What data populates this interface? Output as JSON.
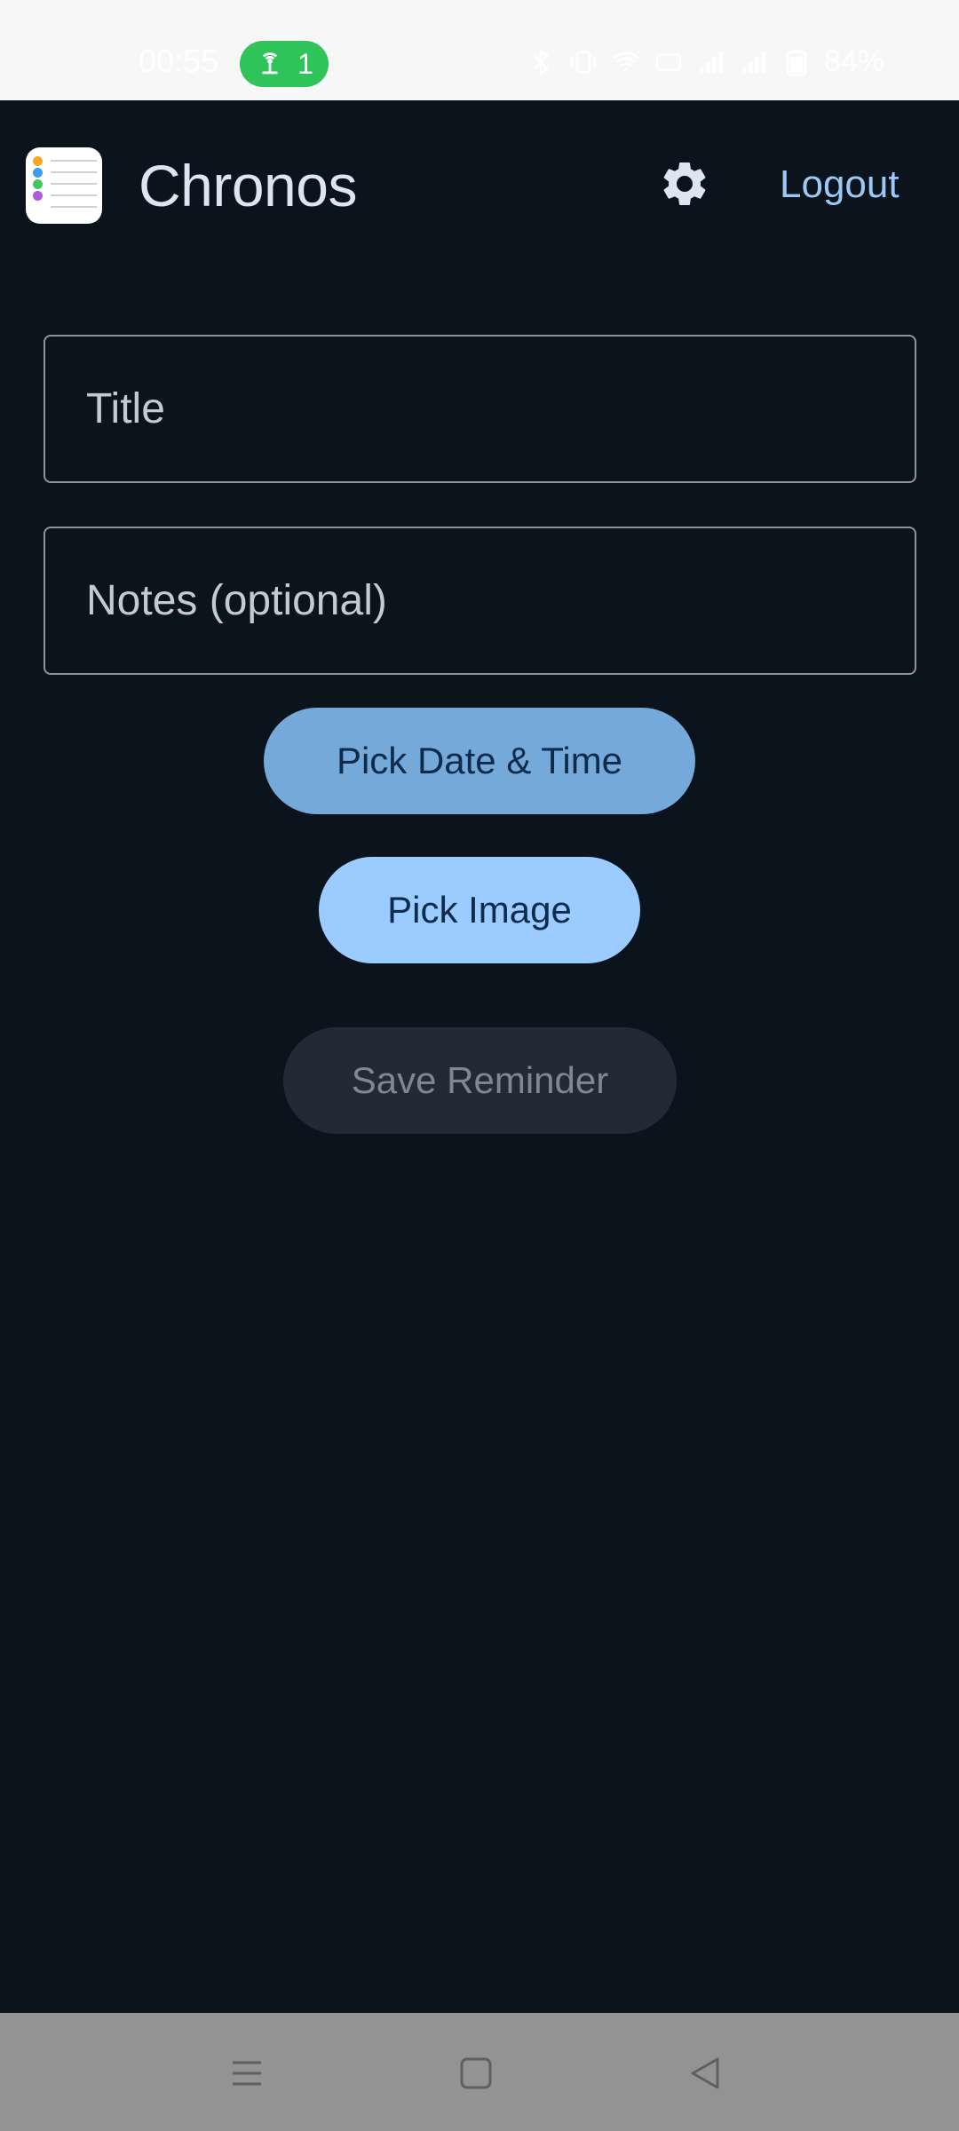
{
  "status_bar": {
    "time": "00:55",
    "hotspot_count": "1",
    "battery": "84%",
    "icons": [
      "bluetooth-icon",
      "vibrate-icon",
      "wifi-icon",
      "hd-icon",
      "signal-icon",
      "signal-icon",
      "battery-icon"
    ]
  },
  "header": {
    "app_name": "Chronos",
    "settings_icon": "gear-icon",
    "logout_label": "Logout"
  },
  "form": {
    "title_placeholder": "Title",
    "title_value": "",
    "notes_placeholder": "Notes (optional)",
    "notes_value": "",
    "pick_date_label": "Pick Date & Time",
    "pick_image_label": "Pick Image",
    "save_label": "Save Reminder"
  },
  "nav": {
    "icons": [
      "menu-icon",
      "home-icon",
      "back-icon"
    ]
  },
  "colors": {
    "background": "#0b131c",
    "accent": "#9ccbff",
    "accent_dim": "#75a9d9",
    "disabled_bg": "#222a35",
    "hotspot_green": "#2ec45a"
  }
}
